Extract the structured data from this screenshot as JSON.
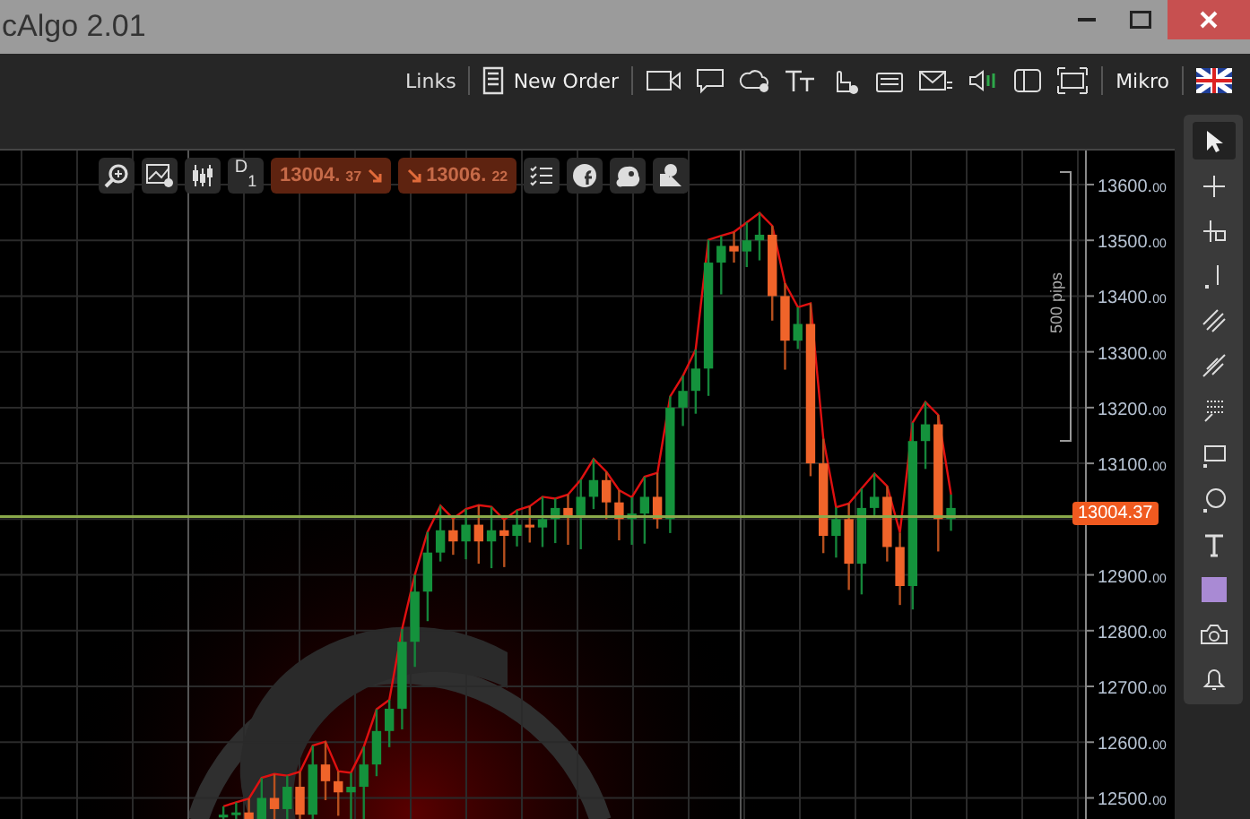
{
  "window": {
    "title": "cAlgo 2.01"
  },
  "toolbar": {
    "links": "Links",
    "new_order": "New Order",
    "account": "Mikro"
  },
  "chart_toolbar": {
    "timeframe": "D",
    "timeframe_count": "1",
    "sell_price": "13004.37",
    "buy_price": "13006.22"
  },
  "chart": {
    "measure_label": "500 pips",
    "current_price": "13004.37",
    "chart_data": {
      "type": "candlestick",
      "ylim": [
        12459,
        13661
      ],
      "grid": true,
      "categories": [
        null,
        null,
        null,
        null,
        null,
        null,
        null,
        null,
        null,
        null,
        null,
        null,
        null,
        null,
        null,
        null,
        null,
        null,
        null,
        null,
        null,
        null,
        null,
        null,
        null,
        null,
        null,
        null,
        null,
        null,
        null,
        null,
        null,
        null,
        null,
        null,
        null,
        null,
        null,
        null,
        null,
        null,
        null,
        null,
        null,
        null,
        null,
        null,
        null,
        null,
        null,
        null,
        null,
        null,
        null,
        null,
        null,
        null,
        null,
        null,
        null,
        null,
        null,
        null,
        null,
        null,
        null,
        null,
        null,
        null,
        null,
        null,
        null,
        null,
        null,
        null,
        null,
        null,
        null,
        null,
        null,
        null,
        null,
        null,
        null
      ],
      "yticks": [
        {
          "value": 13600,
          "label": "13600.00"
        },
        {
          "value": 13500,
          "label": "13500.00"
        },
        {
          "value": 13400,
          "label": "13400.00"
        },
        {
          "value": 13300,
          "label": "13300.00"
        },
        {
          "value": 13200,
          "label": "13200.00"
        },
        {
          "value": 13100,
          "label": "13100.00"
        },
        {
          "value": 12900,
          "label": "12900.00"
        },
        {
          "value": 12800,
          "label": "12800.00"
        },
        {
          "value": 12700,
          "label": "12700.00"
        },
        {
          "value": 12600,
          "label": "12600.00"
        },
        {
          "value": 12500,
          "label": "12500.00"
        }
      ],
      "ref_lines": [
        {
          "axis": "y",
          "value": 13004.37,
          "color": "#8aa84a"
        }
      ],
      "ohlc": [
        null,
        null,
        null,
        null,
        null,
        null,
        null,
        null,
        null,
        null,
        null,
        null,
        null,
        null,
        null,
        null,
        null,
        [
          12465,
          12485,
          12462,
          12470
        ],
        [
          12470,
          12492,
          12460,
          12474
        ],
        [
          12474,
          12499,
          12460,
          12460
        ],
        [
          12460,
          12536,
          12460,
          12500
        ],
        [
          12500,
          12543,
          12460,
          12480
        ],
        [
          12480,
          12540,
          12460,
          12520
        ],
        [
          12520,
          12547,
          12460,
          12470
        ],
        [
          12470,
          12594,
          12460,
          12560
        ],
        [
          12560,
          12601,
          12496,
          12530
        ],
        [
          12530,
          12548,
          12468,
          12510
        ],
        [
          12510,
          12545,
          12460,
          12520
        ],
        [
          12520,
          12592,
          12462,
          12560
        ],
        [
          12560,
          12659,
          12539,
          12620
        ],
        [
          12620,
          12676,
          12591,
          12660
        ],
        [
          12660,
          12803,
          12623,
          12780
        ],
        [
          12780,
          12900,
          12735,
          12870
        ],
        [
          12870,
          12977,
          12817,
          12940
        ],
        [
          12940,
          13024,
          12924,
          12980
        ],
        [
          12980,
          13001,
          12936,
          12960
        ],
        [
          12960,
          13018,
          12928,
          12990
        ],
        [
          12990,
          13025,
          12920,
          12960
        ],
        [
          12960,
          13022,
          12912,
          12980
        ],
        [
          12980,
          12999,
          12914,
          12970
        ],
        [
          12970,
          13016,
          12951,
          12990
        ],
        [
          12990,
          13023,
          12958,
          12985
        ],
        [
          12985,
          13040,
          12950,
          13000
        ],
        [
          13000,
          13037,
          12957,
          13020
        ],
        [
          13020,
          13044,
          12954,
          13005
        ],
        [
          13005,
          13071,
          12946,
          13040
        ],
        [
          13040,
          13108,
          13018,
          13070
        ],
        [
          13070,
          13085,
          13000,
          13030
        ],
        [
          13030,
          13052,
          12962,
          13000
        ],
        [
          13000,
          13039,
          12954,
          13010
        ],
        [
          13010,
          13076,
          12956,
          13040
        ],
        [
          13040,
          13083,
          12983,
          13000
        ],
        [
          13000,
          13220,
          12975,
          13200
        ],
        [
          13200,
          13257,
          13167,
          13230
        ],
        [
          13230,
          13304,
          13189,
          13270
        ],
        [
          13270,
          13501,
          13221,
          13460
        ],
        [
          13460,
          13508,
          13403,
          13490
        ],
        [
          13490,
          13515,
          13460,
          13480
        ],
        [
          13480,
          13532,
          13452,
          13500
        ],
        [
          13500,
          13549,
          13464,
          13510
        ],
        [
          13510,
          13526,
          13356,
          13400
        ],
        [
          13400,
          13423,
          13268,
          13320
        ],
        [
          13320,
          13380,
          13305,
          13350
        ],
        [
          13350,
          13387,
          13077,
          13100
        ],
        [
          13100,
          13144,
          12939,
          12970
        ],
        [
          12970,
          13021,
          12931,
          13000
        ],
        [
          13000,
          13028,
          12873,
          12920
        ],
        [
          12920,
          13055,
          12865,
          13020
        ],
        [
          13020,
          13082,
          13002,
          13040
        ],
        [
          13040,
          13059,
          12924,
          12950
        ],
        [
          12950,
          12976,
          12846,
          12880
        ],
        [
          12880,
          13173,
          12838,
          13140
        ],
        [
          13140,
          13210,
          13090,
          13170
        ],
        [
          13170,
          13187,
          12942,
          13000
        ],
        [
          13000,
          13044,
          12979,
          13020
        ],
        null,
        null,
        null,
        null,
        null,
        null,
        null,
        null,
        null,
        null
      ],
      "series": [
        {
          "type": "line",
          "color": "#e01010",
          "values": [
            null,
            null,
            null,
            null,
            null,
            null,
            null,
            null,
            null,
            null,
            null,
            null,
            null,
            null,
            null,
            null,
            null,
            12485,
            12492,
            12499,
            12536,
            12543,
            12540,
            12547,
            12594,
            12601,
            12548,
            12545,
            12592,
            12659,
            12676,
            12803,
            12900,
            12977,
            13024,
            13001,
            13018,
            13025,
            13022,
            12999,
            13016,
            13023,
            13040,
            13037,
            13044,
            13071,
            13108,
            13085,
            13052,
            13039,
            13076,
            13083,
            13220,
            13257,
            13304,
            13501,
            13508,
            13515,
            13532,
            13549,
            13526,
            13423,
            13380,
            13387,
            13144,
            13021,
            13028,
            13055,
            13082,
            13059,
            12976,
            13173,
            13210,
            13187,
            13044,
            null,
            null,
            null,
            null,
            null,
            null,
            null,
            null,
            null,
            null
          ]
        }
      ]
    }
  }
}
